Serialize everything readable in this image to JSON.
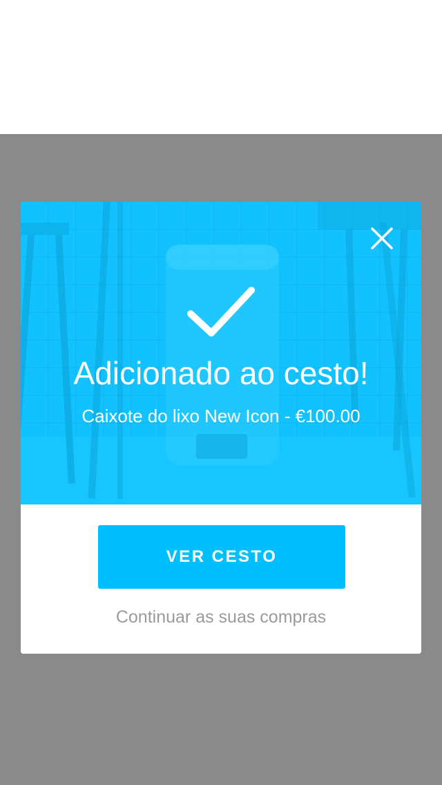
{
  "modal": {
    "title": "Adicionado ao cesto!",
    "subtitle": "Caixote do lixo New Icon - €100.00",
    "primary_label": "VER CESTO",
    "secondary_label": "Continuar as suas compras",
    "icons": {
      "close": "close-icon",
      "check": "checkmark-icon"
    }
  },
  "colors": {
    "overlay": "#8a8a8a",
    "hero": "#12c2fe",
    "button": "#00bfff",
    "link": "#9a9a9a"
  }
}
